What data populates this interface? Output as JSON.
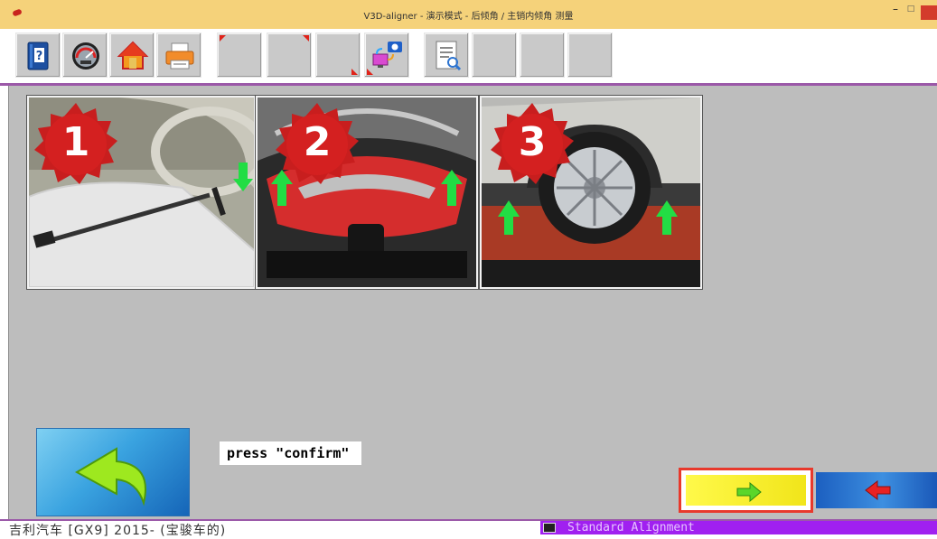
{
  "window": {
    "title": "V3D-aligner - 演示模式 - 后倾角 / 主销内倾角 测量"
  },
  "toolbar": {
    "buttons": [
      {
        "name": "help-button",
        "icon": "help-book-icon"
      },
      {
        "name": "dashboard-button",
        "icon": "gauge-icon"
      },
      {
        "name": "home-button",
        "icon": "home-icon"
      },
      {
        "name": "print-button",
        "icon": "printer-icon"
      },
      {
        "name": "toolbar-slot-5",
        "icon": "empty"
      },
      {
        "name": "toolbar-slot-6",
        "icon": "empty"
      },
      {
        "name": "toolbar-slot-7",
        "icon": "empty"
      },
      {
        "name": "camera-monitor-button",
        "icon": "camera-monitor-icon"
      },
      {
        "name": "report-button",
        "icon": "report-icon"
      },
      {
        "name": "toolbar-slot-10",
        "icon": "empty"
      },
      {
        "name": "toolbar-slot-11",
        "icon": "empty"
      },
      {
        "name": "toolbar-slot-12",
        "icon": "empty"
      }
    ]
  },
  "steps": [
    {
      "number": "1",
      "description_icon": "brake-pedal-depressor-icon"
    },
    {
      "number": "2",
      "description_icon": "turntable-icon"
    },
    {
      "number": "3",
      "description_icon": "rear-wheel-slip-plate-icon"
    }
  ],
  "prompt": {
    "text": "press \"confirm\""
  },
  "nav": {
    "back_icon": "curved-back-arrow-icon",
    "confirm_icon": "right-arrow-icon",
    "previous_icon": "left-arrow-icon"
  },
  "status": {
    "vehicle": "吉利汽车 [GX9] 2015- (宝骏车的)",
    "program": "Standard Alignment"
  },
  "colors": {
    "titlebar": "#f5d27a",
    "accent_purple": "#9b58a8",
    "panel_gray": "#bdbdbd",
    "confirm_yellow": "#fff94a",
    "confirm_border": "#e8392c",
    "step_badge_red": "#c81e1e",
    "arrow_green": "#22dd44"
  }
}
